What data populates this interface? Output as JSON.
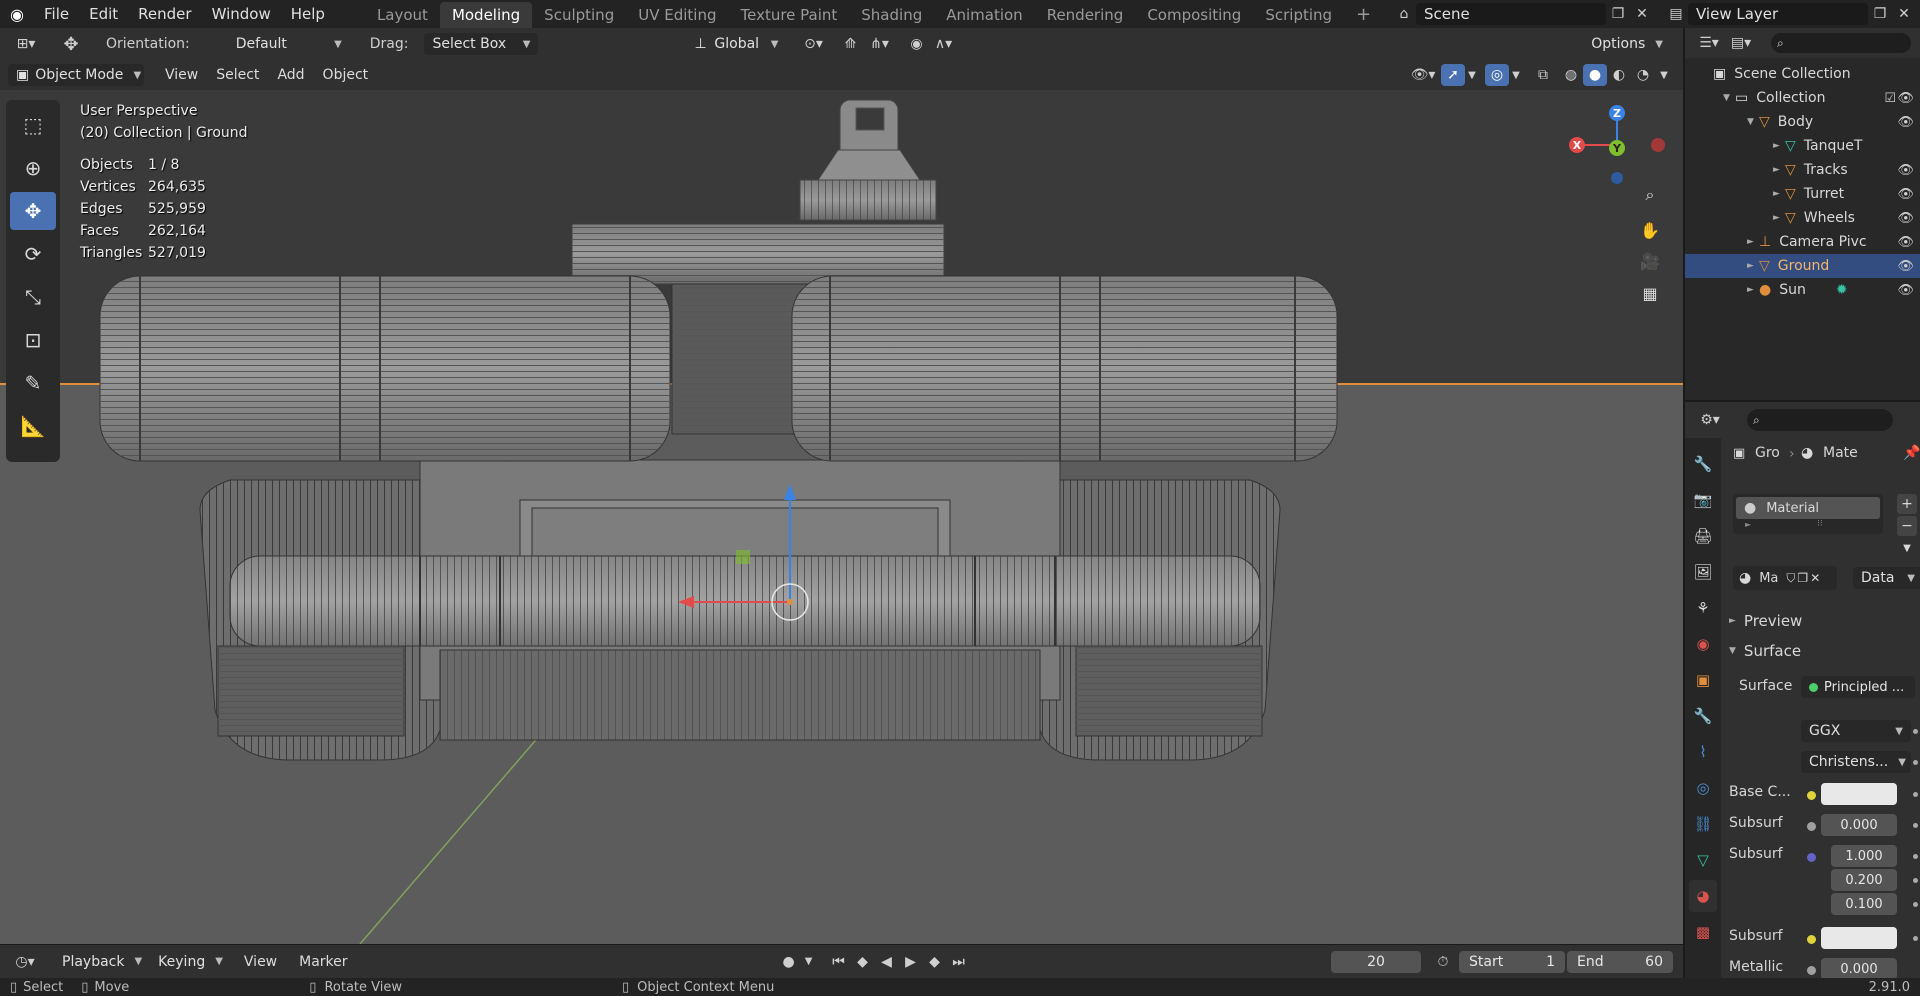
{
  "topbar": {
    "menu": [
      "File",
      "Edit",
      "Render",
      "Window",
      "Help"
    ],
    "workspaces": [
      "Layout",
      "Modeling",
      "Sculpting",
      "UV Editing",
      "Texture Paint",
      "Shading",
      "Animation",
      "Rendering",
      "Compositing",
      "Scripting"
    ],
    "active_workspace": "Modeling",
    "add_tab": "+",
    "scene_name": "Scene",
    "view_layer_name": "View Layer"
  },
  "toolheader": {
    "orientation_label": "Orientation:",
    "orientation_value": "Default",
    "drag_label": "Drag:",
    "drag_value": "Select Box",
    "transform_orientation": "Global",
    "options_label": "Options"
  },
  "viewport_header": {
    "mode": "Object Mode",
    "menus": [
      "View",
      "Select",
      "Add",
      "Object"
    ]
  },
  "overlay": {
    "perspective": "User Perspective",
    "collection_info": "(20) Collection | Ground",
    "stats": [
      {
        "label": "Objects",
        "value": "1 / 8"
      },
      {
        "label": "Vertices",
        "value": "264,635"
      },
      {
        "label": "Edges",
        "value": "525,959"
      },
      {
        "label": "Faces",
        "value": "262,164"
      },
      {
        "label": "Triangles",
        "value": "527,019"
      }
    ]
  },
  "gizmo": {
    "x": "X",
    "y": "Y",
    "z": "Z"
  },
  "outliner": {
    "root": "Scene Collection",
    "items": [
      {
        "name": "Collection",
        "depth": 1
      },
      {
        "name": "Body",
        "depth": 2
      },
      {
        "name": "TanqueT",
        "depth": 3
      },
      {
        "name": "Tracks",
        "depth": 3
      },
      {
        "name": "Turret",
        "depth": 3
      },
      {
        "name": "Wheels",
        "depth": 3
      },
      {
        "name": "Camera Pivc",
        "depth": 2
      },
      {
        "name": "Ground",
        "depth": 2
      },
      {
        "name": "Sun",
        "depth": 2
      }
    ],
    "selected": "Ground"
  },
  "properties": {
    "object_short": "Gro",
    "material_short": "Mate",
    "material_slot": "Material",
    "material_data_short": "Ma",
    "link_dropdown": "Data",
    "preview_panel": "Preview",
    "surface_panel": "Surface",
    "surface_label": "Surface",
    "surface_value": "Principled ...",
    "distribution": "GGX",
    "subsurface_method": "Christens...",
    "rows": [
      {
        "label": "Base C...",
        "value": ""
      },
      {
        "label": "Subsurf",
        "value": "0.000"
      },
      {
        "label": "Subsurf",
        "value": "1.000"
      },
      {
        "label": "",
        "value": "0.200"
      },
      {
        "label": "",
        "value": "0.100"
      },
      {
        "label": "Subsurf",
        "value": ""
      },
      {
        "label": "Metallic",
        "value": "0.000"
      }
    ]
  },
  "timeline": {
    "menus": [
      "Playback",
      "Keying",
      "View",
      "Marker"
    ],
    "current_frame": "20",
    "start_label": "Start",
    "start_value": "1",
    "end_label": "End",
    "end_value": "60"
  },
  "statusbar": {
    "select": "Select",
    "move": "Move",
    "rotate": "Rotate View",
    "context_menu": "Object Context Menu",
    "version": "2.91.0"
  },
  "colors": {
    "accent_blue": "#4a72b3",
    "selection": "#334d80",
    "object_orange": "#e08e3c",
    "x_axis": "#e34a4a",
    "y_axis": "#7fbf2f",
    "z_axis": "#3a83e6"
  }
}
